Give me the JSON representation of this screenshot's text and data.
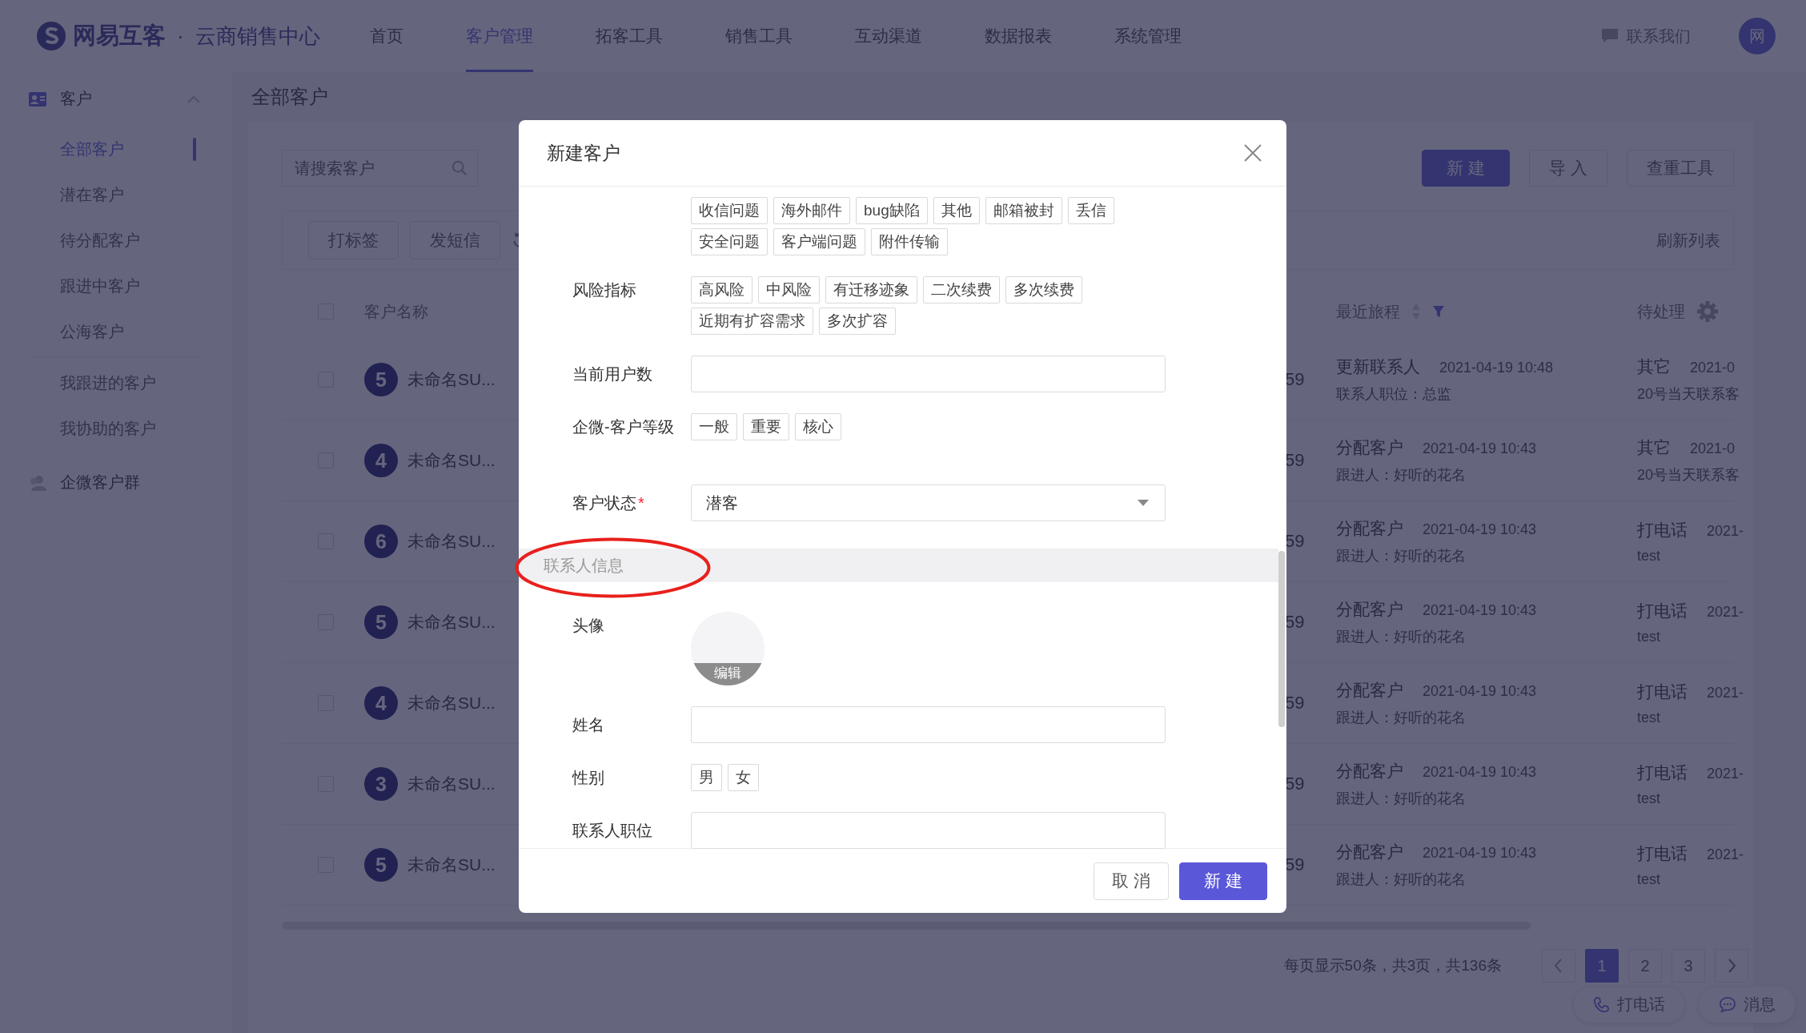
{
  "top_bar": {
    "brand": "网易互客",
    "separator": "·",
    "product": "云商销售中心",
    "nav": [
      {
        "label": "首页",
        "selected": false
      },
      {
        "label": "客户管理",
        "selected": true
      },
      {
        "label": "拓客工具",
        "selected": false
      },
      {
        "label": "销售工具",
        "selected": false
      },
      {
        "label": "互动渠道",
        "selected": false
      },
      {
        "label": "数据报表",
        "selected": false
      },
      {
        "label": "系统管理",
        "selected": false
      }
    ],
    "contact": "联系我们",
    "avatar": "网"
  },
  "sidebar": {
    "groups": [
      {
        "label": "客户",
        "kind": "contacts",
        "expanded": true,
        "sections": [
          [
            {
              "label": "全部客户",
              "selected": true
            },
            {
              "label": "潜在客户",
              "selected": false
            },
            {
              "label": "待分配客户",
              "selected": false
            },
            {
              "label": "跟进中客户",
              "selected": false
            },
            {
              "label": "公海客户",
              "selected": false
            }
          ],
          [
            {
              "label": "我跟进的客户",
              "selected": false
            },
            {
              "label": "我协助的客户",
              "selected": false
            }
          ]
        ]
      },
      {
        "label": "企微客户群",
        "kind": "groups"
      }
    ]
  },
  "page_title": "全部客户",
  "toolbar": {
    "search": {
      "placeholder": "请搜索客户"
    },
    "buttons": [
      {
        "label": "新 建",
        "kind": "primary"
      },
      {
        "label": "导 入",
        "kind": "default"
      },
      {
        "label": "查重工具",
        "kind": "default"
      }
    ]
  },
  "actions": {
    "buttons": [
      "打标签",
      "发短信"
    ],
    "refresh": "刷新列表"
  },
  "table": {
    "select_all_checked": false,
    "columns": [
      {
        "label": "客户名称"
      },
      {
        "label": "最近旅程"
      },
      {
        "label": "待处理"
      }
    ],
    "rows": [
      {
        "checked": false,
        "badge": "5",
        "name": "未命名SU...",
        "column_3": "59",
        "journey": {
          "title": "更新联系人",
          "time": "2021-04-19 10:48",
          "detail": "联系人职位：总监"
        },
        "pending": {
          "title": "其它",
          "time": "2021-0",
          "detail": "20号当天联系客"
        }
      },
      {
        "checked": false,
        "badge": "4",
        "name": "未命名SU...",
        "column_3": "59",
        "journey": {
          "title": "分配客户",
          "time": "2021-04-19 10:43",
          "detail": "跟进人：好听的花名"
        },
        "pending": {
          "title": "其它",
          "time": "2021-0",
          "detail": "20号当天联系客"
        }
      },
      {
        "checked": false,
        "badge": "6",
        "name": "未命名SU...",
        "column_3": "59",
        "journey": {
          "title": "分配客户",
          "time": "2021-04-19 10:43",
          "detail": "跟进人：好听的花名"
        },
        "pending": {
          "title": "打电话",
          "time": "2021-",
          "detail": "test"
        }
      },
      {
        "checked": false,
        "badge": "5",
        "name": "未命名SU...",
        "column_3": "59",
        "journey": {
          "title": "分配客户",
          "time": "2021-04-19 10:43",
          "detail": "跟进人：好听的花名"
        },
        "pending": {
          "title": "打电话",
          "time": "2021-",
          "detail": "test"
        }
      },
      {
        "checked": false,
        "badge": "4",
        "name": "未命名SU...",
        "column_3": "59",
        "journey": {
          "title": "分配客户",
          "time": "2021-04-19 10:43",
          "detail": "跟进人：好听的花名"
        },
        "pending": {
          "title": "打电话",
          "time": "2021-",
          "detail": "test"
        }
      },
      {
        "checked": false,
        "badge": "3",
        "name": "未命名SU...",
        "column_3": "59",
        "journey": {
          "title": "分配客户",
          "time": "2021-04-19 10:43",
          "detail": "跟进人：好听的花名"
        },
        "pending": {
          "title": "打电话",
          "time": "2021-",
          "detail": "test"
        }
      },
      {
        "checked": false,
        "badge": "5",
        "name": "未命名SU...",
        "column_3": "59",
        "journey": {
          "title": "分配客户",
          "time": "2021-04-19 10:43",
          "detail": "跟进人：好听的花名"
        },
        "pending": {
          "title": "打电话",
          "time": "2021-",
          "detail": "test"
        }
      }
    ]
  },
  "pagination": {
    "summary": "每页显示50条，共3页，共136条",
    "pages": [
      {
        "label": "1",
        "selected": true
      },
      {
        "label": "2",
        "selected": false
      },
      {
        "label": "3",
        "selected": false
      }
    ]
  },
  "floating": [
    {
      "label": "打电话",
      "kind": "phone"
    },
    {
      "label": "消息",
      "kind": "message"
    }
  ],
  "modal": {
    "title": "新建客户",
    "fields": [
      {
        "kind": "tags",
        "tag_rows": [
          [
            {
              "label": "收信问题",
              "selected": false
            },
            {
              "label": "海外邮件",
              "selected": false
            },
            {
              "label": "bug缺陷",
              "selected": false
            },
            {
              "label": "其他",
              "selected": false
            },
            {
              "label": "邮箱被封",
              "selected": false
            },
            {
              "label": "丢信",
              "selected": false
            }
          ],
          [
            {
              "label": "安全问题",
              "selected": false
            },
            {
              "label": "客户端问题",
              "selected": false
            },
            {
              "label": "附件传输",
              "selected": false
            }
          ]
        ]
      },
      {
        "kind": "tags",
        "label": "风险指标",
        "tag_rows": [
          [
            {
              "label": "高风险",
              "selected": false
            },
            {
              "label": "中风险",
              "selected": false
            },
            {
              "label": "有迁移迹象",
              "selected": false
            },
            {
              "label": "二次续费",
              "selected": false
            },
            {
              "label": "多次续费",
              "selected": false
            }
          ],
          [
            {
              "label": "近期有扩容需求",
              "selected": false
            },
            {
              "label": "多次扩容",
              "selected": false
            }
          ]
        ]
      },
      {
        "kind": "input",
        "label": "当前用户数"
      },
      {
        "kind": "tags",
        "label": "企微-客户等级",
        "tag_rows": [
          [
            {
              "label": "一般",
              "selected": false
            },
            {
              "label": "重要",
              "selected": false
            },
            {
              "label": "核心",
              "selected": false
            }
          ]
        ]
      },
      {
        "kind": "select",
        "label": "客户状态",
        "required_mark": "*",
        "value": "潜客"
      },
      {
        "kind": "section",
        "label": "联系人信息",
        "highlighted": true
      },
      {
        "kind": "avatar",
        "label": "头像",
        "action": "编辑"
      },
      {
        "kind": "input",
        "label": "姓名"
      },
      {
        "kind": "tags",
        "label": "性别",
        "tag_rows": [
          [
            {
              "label": "男",
              "selected": false
            },
            {
              "label": "女",
              "selected": false
            }
          ]
        ]
      },
      {
        "kind": "input",
        "label": "联系人职位"
      }
    ],
    "buttons": [
      {
        "label": "取 消",
        "kind": "default"
      },
      {
        "label": "新 建",
        "kind": "primary"
      }
    ]
  }
}
